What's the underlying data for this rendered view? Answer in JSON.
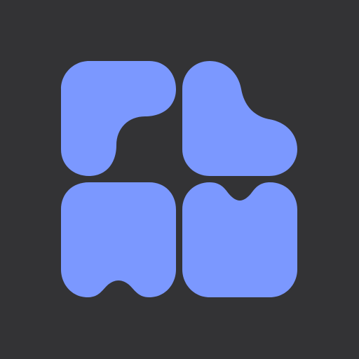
{
  "logo": {
    "icon": "four-tile-blob-logo-icon",
    "colors": {
      "background": "#333335",
      "tile": "#7B98FF"
    },
    "tiles": [
      {
        "name": "top-left-tile"
      },
      {
        "name": "top-right-tile"
      },
      {
        "name": "bottom-left-tile"
      },
      {
        "name": "bottom-right-tile"
      }
    ]
  }
}
